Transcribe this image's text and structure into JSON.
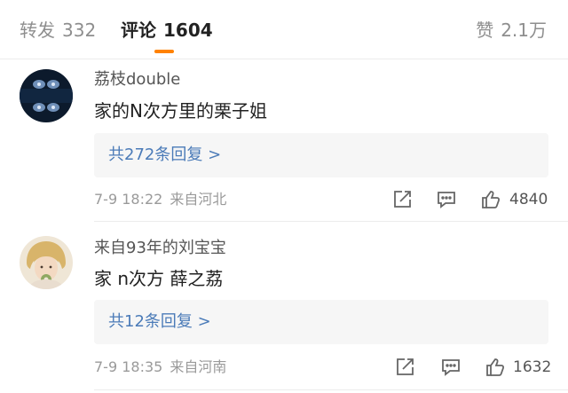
{
  "tabs": {
    "repost": {
      "label": "转发",
      "count": "332"
    },
    "comment": {
      "label": "评论",
      "count": "1604"
    },
    "like": {
      "label": "赞",
      "count": "2.1万"
    }
  },
  "colors": {
    "accent": "#ff8200",
    "link": "#4b7bb8",
    "muted": "#9a9a9a"
  },
  "comments": [
    {
      "nickname": "荔枝double",
      "text": "家的N次方里的栗子姐",
      "replies_label": "共272条回复 >",
      "date": "7-9 18:22",
      "location": "来自河北",
      "likes": "4840",
      "icons": [
        "share-icon",
        "comment-icon",
        "thumbs-up-icon"
      ]
    },
    {
      "nickname": "来自93年的刘宝宝",
      "text": "家 n次方 薛之荔",
      "replies_label": "共12条回复 >",
      "date": "7-9 18:35",
      "location": "来自河南",
      "likes": "1632",
      "icons": [
        "share-icon",
        "comment-icon",
        "thumbs-up-icon"
      ]
    }
  ]
}
